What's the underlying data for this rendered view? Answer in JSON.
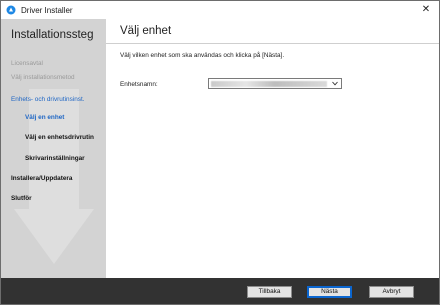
{
  "window": {
    "title": "Driver Installer",
    "close_glyph": "✕",
    "icon": "driver-installer-icon"
  },
  "sidebar": {
    "title": "Installationssteg",
    "steps": [
      {
        "label": "Licensavtal",
        "state": "done"
      },
      {
        "label": "Välj installationsmetod",
        "state": "done"
      },
      {
        "label": "Enhets- och drivrutinsinst.",
        "state": "current-parent"
      },
      {
        "label": "Välj en enhet",
        "state": "current"
      },
      {
        "label": "Välj en enhetsdrivrutin",
        "state": "pending"
      },
      {
        "label": "Skrivarinställningar",
        "state": "pending"
      },
      {
        "label": "Installera/Uppdatera",
        "state": "pending"
      },
      {
        "label": "Slutför",
        "state": "pending"
      }
    ]
  },
  "main": {
    "title": "Välj enhet",
    "instruction": "Välj vilken enhet som ska användas och klicka på [Nästa].",
    "device_label": "Enhetsnamn:",
    "device_value": ""
  },
  "buttons": {
    "back": "Tillbaka",
    "next": "Nästa",
    "cancel": "Avbryt"
  },
  "colors": {
    "sidebar_bg": "#d3d3d3",
    "active_step": "#1f66c4",
    "bottom_bar": "#323232"
  }
}
